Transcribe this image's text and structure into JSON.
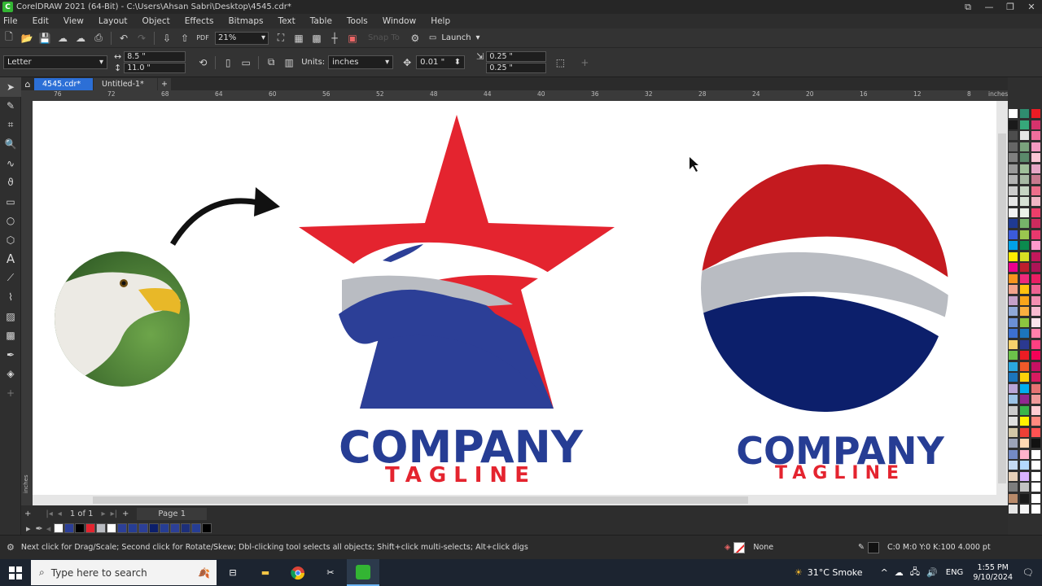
{
  "window": {
    "title": "CorelDRAW 2021 (64-Bit) - C:\\Users\\Ahsan Sabri\\Desktop\\4545.cdr*",
    "app_icon_letter": "C"
  },
  "menu": [
    "File",
    "Edit",
    "View",
    "Layout",
    "Object",
    "Effects",
    "Bitmaps",
    "Text",
    "Table",
    "Tools",
    "Window",
    "Help"
  ],
  "toolbar": {
    "zoom_value": "21%",
    "snap_label": "Snap To",
    "launch_label": "Launch"
  },
  "property_bar": {
    "page_size": "Letter",
    "width": "8.5 \"",
    "height": "11.0 \"",
    "units_label": "Units:",
    "units_value": "inches",
    "nudge": "0.01 \"",
    "dup_x": "0.25 \"",
    "dup_y": "0.25 \""
  },
  "tabs": {
    "active": "4545.cdr*",
    "inactive": "Untitled-1*"
  },
  "ruler": {
    "labels": [
      "76",
      "72",
      "68",
      "64",
      "60",
      "56",
      "52",
      "48",
      "44",
      "40",
      "36",
      "32",
      "28",
      "24",
      "20",
      "16",
      "12",
      "8"
    ],
    "unit": "inches",
    "left_unit": "inches"
  },
  "artwork": {
    "logo1_company": "COMPANY",
    "logo1_tagline": "TAGLINE",
    "logo2_company": "COMPANY",
    "logo2_tagline": "TAGLINE",
    "colors": {
      "red": "#e4242f",
      "blue": "#2c3f97",
      "navy": "#0c1f6b",
      "gray": "#b9bcc2",
      "dark_red": "#c41a1f"
    }
  },
  "page_nav": {
    "page_count": "1 of 1",
    "page_tab": "Page 1"
  },
  "status": {
    "message": "Next click for Drag/Scale; Second click for Rotate/Skew; Dbl-clicking tool selects all objects; Shift+click multi-selects; Alt+click digs",
    "fill_label": "None",
    "outline_info": "C:0 M:0 Y:0 K:100  4.000 pt"
  },
  "taskbar": {
    "search_placeholder": "Type here to search",
    "weather": "31°C  Smoke",
    "language": "ENG",
    "time": "1:55 PM",
    "date": "9/10/2024"
  }
}
